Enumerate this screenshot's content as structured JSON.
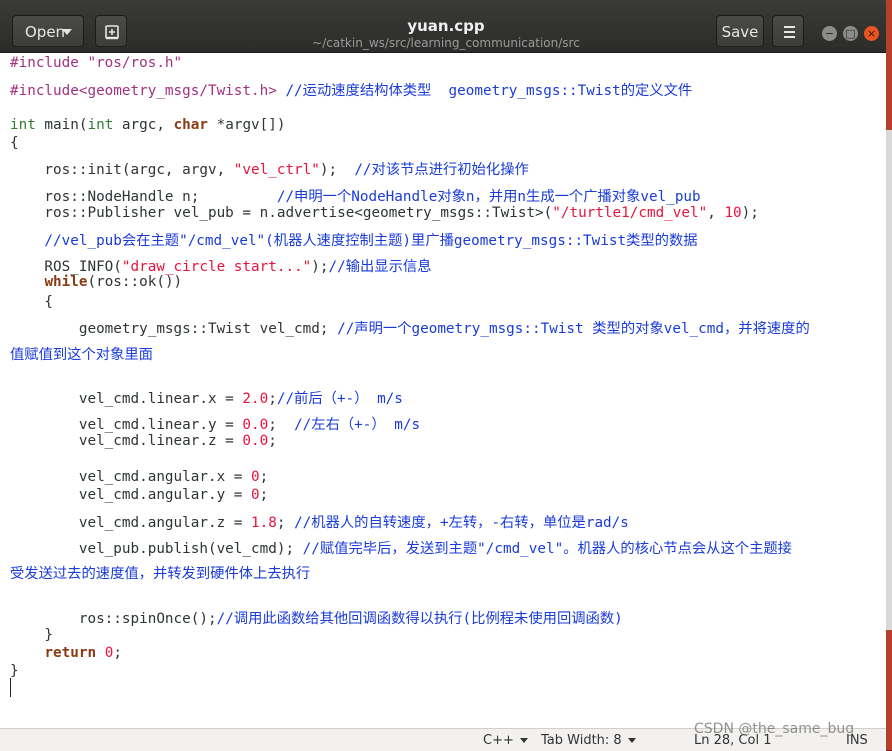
{
  "window": {
    "title": "yuan.cpp",
    "subtitle": "~/catkin_ws/src/learning_communication/src"
  },
  "header": {
    "open_label": "Open",
    "save_label": "Save",
    "minimize_glyph": "−",
    "maximize_glyph": "□",
    "close_glyph": "×"
  },
  "code": {
    "l1": "#include \"ros/ros.h\"",
    "l2": "#include<geometry_msgs/Twist.h>",
    "l2c": " //运动速度结构体类型  geometry_msgs::Twist的定义文件",
    "l3a": "int",
    "l3b": " main(",
    "l3c": "int",
    "l3d": " argc, ",
    "l3e": "char",
    "l3f": " *argv[])",
    "l4": "{",
    "l5a": "    ros::init(argc, argv, ",
    "l5s": "\"vel_ctrl\"",
    "l5b": ");  ",
    "l5c": "//对该节点进行初始化操作",
    "l6a": "    ros::NodeHandle n;         ",
    "l6c": "//申明一个NodeHandle对象n，并用n生成一个广播对象vel_pub",
    "l7a": "    ros::Publisher vel_pub = n.advertise<geometry_msgs::Twist>(",
    "l7s": "\"/turtle1/cmd_vel\"",
    "l7b": ", ",
    "l7n": "10",
    "l7e": ");",
    "l8c": "    //vel_pub会在主题\"/cmd_vel\"(机器人速度控制主题)里广播geometry_msgs::Twist类型的数据",
    "l9a": "    ROS_INFO(",
    "l9s": "\"draw_circle start...\"",
    "l9b": ");",
    "l9c": "//输出显示信息",
    "l10a": "    ",
    "l10k": "while",
    "l10b": "(ros::ok())",
    "l11": "    {",
    "l12a": "        geometry_msgs::Twist vel_cmd; ",
    "l12c": "//声明一个geometry_msgs::Twist 类型的对象vel_cmd，并将速度的",
    "l12w": "值赋值到这个对象里面",
    "l13a": "        vel_cmd.linear.x = ",
    "l13n": "2.0",
    "l13b": ";",
    "l13c": "//前后（+-） m/s",
    "l14a": "        vel_cmd.linear.y = ",
    "l14n": "0.0",
    "l14b": ";  ",
    "l14c": "//左右（+-） m/s",
    "l15a": "        vel_cmd.linear.z = ",
    "l15n": "0.0",
    "l15b": ";",
    "l16a": "        vel_cmd.angular.x = ",
    "l16n": "0",
    "l16b": ";",
    "l17a": "        vel_cmd.angular.y = ",
    "l17n": "0",
    "l17b": ";",
    "l18a": "        vel_cmd.angular.z = ",
    "l18n": "1.8",
    "l18b": "; ",
    "l18c": "//机器人的自转速度，+左转，-右转，单位是rad/s",
    "l19a": "        vel_pub.publish(vel_cmd); ",
    "l19c": "//赋值完毕后，发送到主题\"/cmd_vel\"。机器人的核心节点会从这个主题接",
    "l19w": "受发送过去的速度值，并转发到硬件体上去执行",
    "l20a": "        ros::spinOnce();",
    "l20c": "//调用此函数给其他回调函数得以执行(比例程未使用回调函数)",
    "l21": "    }",
    "l22a": "    ",
    "l22k": "return",
    "l22b": " ",
    "l22n": "0",
    "l22e": ";",
    "l23": "}"
  },
  "status": {
    "language": "C++",
    "tab_width": "Tab Width: 8",
    "position": "Ln 28, Col 1",
    "mode": "INS"
  },
  "watermark": "CSDN @the_same_bug",
  "colors": {
    "comment": "#1a3bd9",
    "string": "#e8143d",
    "keyword": "#8a3b12",
    "preprocessor": "#a2317f",
    "type": "#2e7d32",
    "close_button": "#e95420"
  }
}
